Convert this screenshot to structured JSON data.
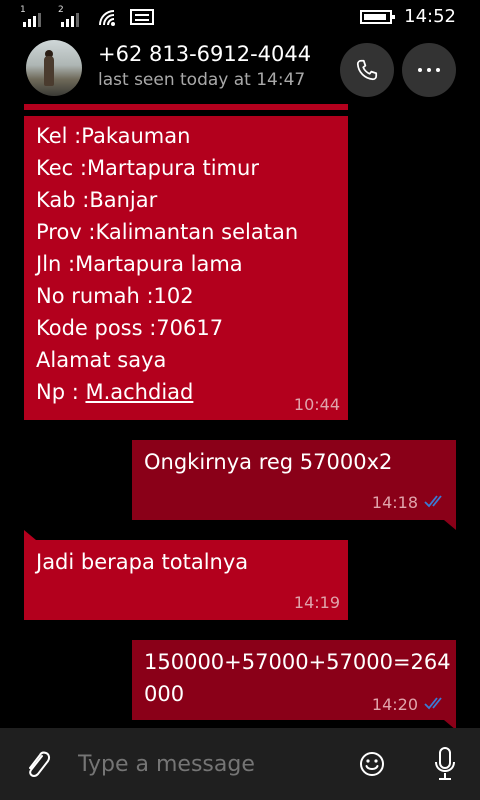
{
  "status_bar": {
    "sim1": "1",
    "sim2": "2",
    "time": "14:52"
  },
  "header": {
    "contact_name": "+62 813-6912-4044",
    "last_seen": "last seen today at 14:47"
  },
  "messages": [
    {
      "direction": "incoming",
      "lines": [
        "Kel :Pakauman",
        "Kec :Martapura timur",
        "Kab :Banjar",
        "Prov :Kalimantan selatan",
        "Jln :Martapura lama",
        "No rumah :102",
        "Kode poss :70617",
        "Alamat saya"
      ],
      "np_prefix": "Np : ",
      "np_link": "M.achdiad",
      "time": "10:44"
    },
    {
      "direction": "outgoing",
      "text": "Ongkirnya reg 57000x2",
      "time": "14:18"
    },
    {
      "direction": "incoming",
      "text": "Jadi berapa totalnya",
      "time": "14:19"
    },
    {
      "direction": "outgoing",
      "line1": "150000+57000+57000=264",
      "line2": "000",
      "time": "14:20"
    }
  ],
  "composer": {
    "placeholder": "Type a message"
  },
  "colors": {
    "incoming_bubble": "#b3001d",
    "outgoing_bubble": "#8a0018",
    "read_tick": "#3a7bd5"
  }
}
